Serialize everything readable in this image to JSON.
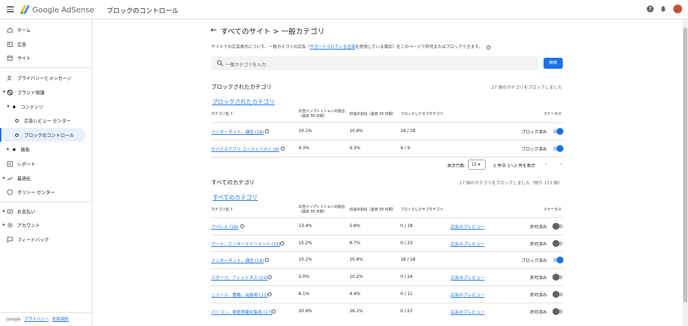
{
  "header": {
    "brand_google": "Google",
    "brand_adsense": "AdSense",
    "page_title": "ブロックのコントロール"
  },
  "sidebar": {
    "items": [
      {
        "label": "ホーム",
        "icon": "home-icon"
      },
      {
        "label": "広告",
        "icon": "ads-icon"
      },
      {
        "label": "サイト",
        "icon": "sites-icon"
      },
      {
        "label": "プライバシーとメッセージ",
        "icon": "privacy-icon"
      },
      {
        "label": "ブランド保護",
        "icon": "block-icon"
      },
      {
        "label": "コンテンツ",
        "icon": "dot-icon"
      },
      {
        "label": "広告レビュー センター",
        "icon": "circle-icon"
      },
      {
        "label": "ブロックのコントロール",
        "icon": "circle-icon"
      },
      {
        "label": "検索",
        "icon": "dot-icon"
      },
      {
        "label": "レポート",
        "icon": "report-icon"
      },
      {
        "label": "最適化",
        "icon": "trend-icon"
      },
      {
        "label": "ポリシー センター",
        "icon": "policy-icon"
      },
      {
        "label": "お支払い",
        "icon": "payment-icon"
      },
      {
        "label": "アカウント",
        "icon": "gear-icon"
      },
      {
        "label": "フィードバック",
        "icon": "feedback-icon"
      }
    ],
    "footer": {
      "google": "Google",
      "privacy": "プライバシー",
      "terms": "利用規約"
    }
  },
  "main": {
    "title": "すべてのサイト > 一般カテゴリ",
    "description_before": "サイトでの広告表示について、一般カテゴリの広告（",
    "description_link": "サポートされている言語",
    "description_after": "を使用している場合）をこのページで許可またはブロックできます。",
    "search_placeholder": "一般カテゴリを入力",
    "search_button": "検索",
    "blocked": {
      "title": "ブロックされたカテゴリ",
      "count": "27 個のカテゴリをブロックしました",
      "link": "ブロックされたカテゴリ",
      "headers": {
        "name": "カテゴリ名",
        "impressions": "広告インプレッションの割合",
        "impressions_sub": "（過去 30 日間）",
        "revenue": "収益の割合（過去 30 日間）",
        "subcategories": "ブロックしたサブカテゴリ",
        "status": "ステータス"
      },
      "rows": [
        {
          "name": "インターネット、通信 (18)",
          "impressions": "10.1%",
          "revenue": "10.8%",
          "sub": "18 / 18",
          "status": "ブロック済み",
          "on": true
        },
        {
          "name": "モバイルアプリ ユーティリティ (9)",
          "impressions": "4.3%",
          "revenue": "9.3%",
          "sub": "9 / 9",
          "status": "ブロック済み",
          "on": true
        }
      ],
      "pager": {
        "rows_label": "表示行数:",
        "rows_value": "15",
        "range": "2 件中 1～2 件を表示"
      }
    },
    "all": {
      "title": "すべてのカテゴリ",
      "count": "27 個のカテゴリをブロックしました（残り 173 個）",
      "link": "すべてのカテゴリ",
      "headers": {
        "name": "カテゴリ名",
        "impressions": "広告インプレッションの割合",
        "impressions_sub": "（過去 30 日間）",
        "revenue": "収益の割合（過去 30 日間）",
        "subcategories": "ブロックしたサブカテゴリ",
        "status": "ステータス"
      },
      "rows": [
        {
          "name": "アパレル (18)",
          "impressions": "13.4%",
          "revenue": "5.8%",
          "sub": "0 / 18",
          "preview": "広告のプレビュー",
          "status": "許可済み",
          "on": false
        },
        {
          "name": "アート、エンターテインメント (23)",
          "impressions": "15.2%",
          "revenue": "8.7%",
          "sub": "0 / 23",
          "preview": "広告のプレビュー",
          "status": "許可済み",
          "on": false
        },
        {
          "name": "インターネット、通信 (18)",
          "impressions": "10.1%",
          "revenue": "10.8%",
          "sub": "18 / 18",
          "preview": "",
          "status": "ブロック済み",
          "on": true
        },
        {
          "name": "スポーツ、フィットネス (24)",
          "impressions": "2.0%",
          "revenue": "10.2%",
          "sub": "0 / 24",
          "preview": "広告のプレビュー",
          "status": "許可済み",
          "on": false
        },
        {
          "name": "ニュース、書籍、出版物 (11)",
          "impressions": "8.1%",
          "revenue": "4.4%",
          "sub": "0 / 11",
          "preview": "広告のプレビュー",
          "status": "許可済み",
          "on": false
        },
        {
          "name": "パソコン、家庭用電化製品 (27)",
          "impressions": "20.9%",
          "revenue": "26.1%",
          "sub": "0 / 27",
          "preview": "広告のプレビュー",
          "status": "許可済み",
          "on": false
        }
      ]
    }
  },
  "colors": {
    "accent": "#1a73e8",
    "toggle_off": "#5f6368"
  }
}
